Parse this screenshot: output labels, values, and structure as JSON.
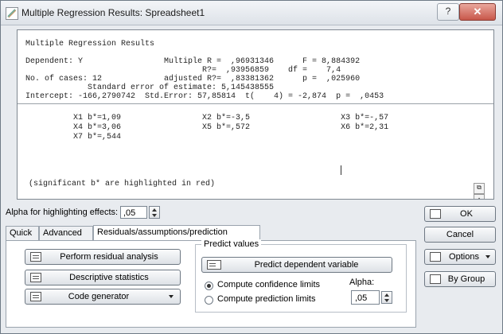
{
  "window": {
    "title": "Multiple Regression Results: Spreadsheet1",
    "help": "?",
    "close": "✕"
  },
  "output": {
    "heading": "Multiple Regression Results",
    "summary_lines": [
      "Dependent: Y                 Multiple R =  ,96931346      F = 8,884392",
      "                                     R?=  ,93956859    df =    7,4",
      "No. of cases: 12             adjusted R?=  ,83381362      p =  ,025960",
      "             Standard error of estimate: 5,145438555",
      "Intercept: -166,2790742  Std.Error: 57,85814  t(    4) = -2,874  p =  ,0453"
    ],
    "coef_lines": [
      "          X1 b*=1,09                 X2 b*=-3,5                   X3 b*=-,57",
      "          X4 b*=3,06                 X5 b*=,572                   X6 b*=2,31",
      "          X7 b*=,544"
    ],
    "note": "(significant b* are highlighted in red)"
  },
  "alpha_effects": {
    "label": "Alpha for highlighting effects:",
    "value": ",05"
  },
  "tabs": [
    {
      "label": "Quick",
      "active": false
    },
    {
      "label": "Advanced",
      "active": false
    },
    {
      "label": "Residuals/assumptions/prediction",
      "active": true
    }
  ],
  "left_buttons": {
    "residual": "Perform residual analysis",
    "descriptive": "Descriptive statistics",
    "codegen": "Code generator"
  },
  "predict": {
    "group_title": "Predict values",
    "button": "Predict dependent variable",
    "radio_confidence": "Compute confidence limits",
    "radio_prediction": "Compute prediction limits",
    "alpha_label": "Alpha:",
    "alpha_value": ",05"
  },
  "right_buttons": {
    "ok": "OK",
    "cancel": "Cancel",
    "options": "Options",
    "bygroup": "By Group"
  }
}
